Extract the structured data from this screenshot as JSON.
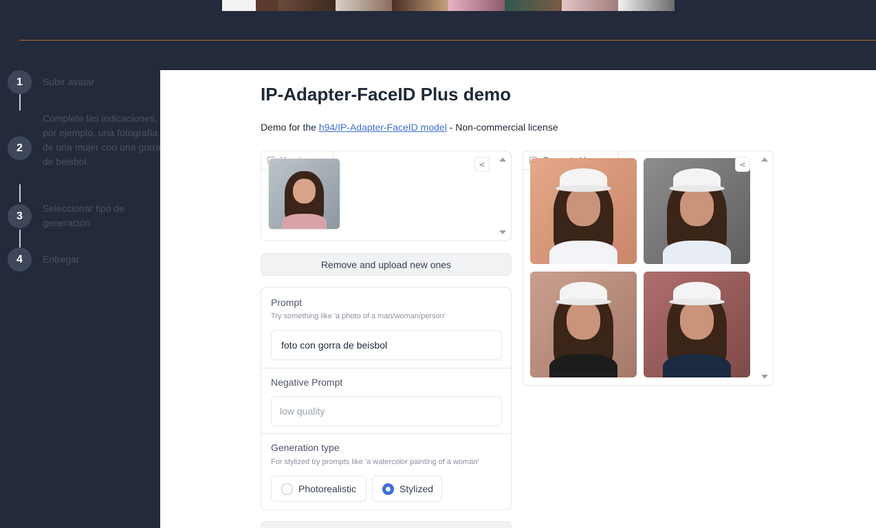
{
  "steps": [
    {
      "num": "1",
      "label": "Subir avatar"
    },
    {
      "num": "2",
      "label": "Complete las indicaciones, por ejemplo, una fotografía de una mujer con una gorra de béisbol."
    },
    {
      "num": "3",
      "label": "Seleccionar tipo de generación"
    },
    {
      "num": "4",
      "label": "Entregar"
    }
  ],
  "demo": {
    "title": "IP-Adapter-FaceID Plus demo",
    "desc_prefix": "Demo for the ",
    "link_text": "h94/IP-Adapter-FaceID model",
    "desc_suffix": " - Non-commercial license"
  },
  "your_images": {
    "label": "Your images"
  },
  "generated_images": {
    "label": "Generated Images"
  },
  "remove_button": "Remove and upload new ones",
  "prompt": {
    "label": "Prompt",
    "info": "Try something like 'a photo of a man/woman/person'",
    "value": "foto con gorra de beisbol"
  },
  "negative_prompt": {
    "label": "Negative Prompt",
    "placeholder": "low quality"
  },
  "generation_type": {
    "label": "Generation type",
    "info": "For stylized try prompts like 'a watercolor painting of a woman'",
    "options": [
      "Photorealistic",
      "Stylized"
    ],
    "selected": "Stylized"
  },
  "icons": {
    "share": "share-icon",
    "image": "image-icon"
  }
}
